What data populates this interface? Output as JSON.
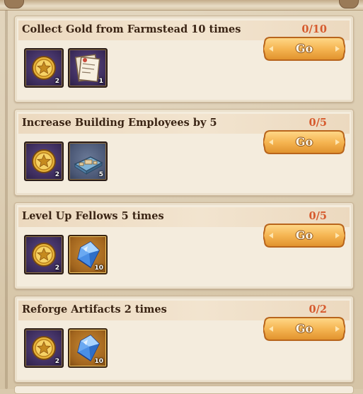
{
  "tasks": [
    {
      "title": "Collect Gold from Farmstead 10 times",
      "progress": "0/10",
      "rewards": [
        {
          "icon": "gold-coin-icon",
          "qty": "2"
        },
        {
          "icon": "blueprint-scroll-icon",
          "qty": "1"
        }
      ],
      "button_label": "Go"
    },
    {
      "title": "Increase Building Employees by 5",
      "progress": "0/5",
      "rewards": [
        {
          "icon": "gold-coin-icon",
          "qty": "2"
        },
        {
          "icon": "building-blueprint-icon",
          "qty": "5"
        }
      ],
      "button_label": "Go"
    },
    {
      "title": "Level Up Fellows 5 times",
      "progress": "0/5",
      "rewards": [
        {
          "icon": "gold-coin-icon",
          "qty": "2"
        },
        {
          "icon": "blue-crystal-icon",
          "qty": "10"
        }
      ],
      "button_label": "Go"
    },
    {
      "title": "Reforge Artifacts 2 times",
      "progress": "0/2",
      "rewards": [
        {
          "icon": "gold-coin-icon",
          "qty": "2"
        },
        {
          "icon": "blue-crystal-icon",
          "qty": "10"
        }
      ],
      "button_label": "Go"
    }
  ],
  "colors": {
    "progress": "#d65a2d",
    "title": "#3a2414",
    "button": "#f5b552",
    "card": "#f4ecdd"
  }
}
